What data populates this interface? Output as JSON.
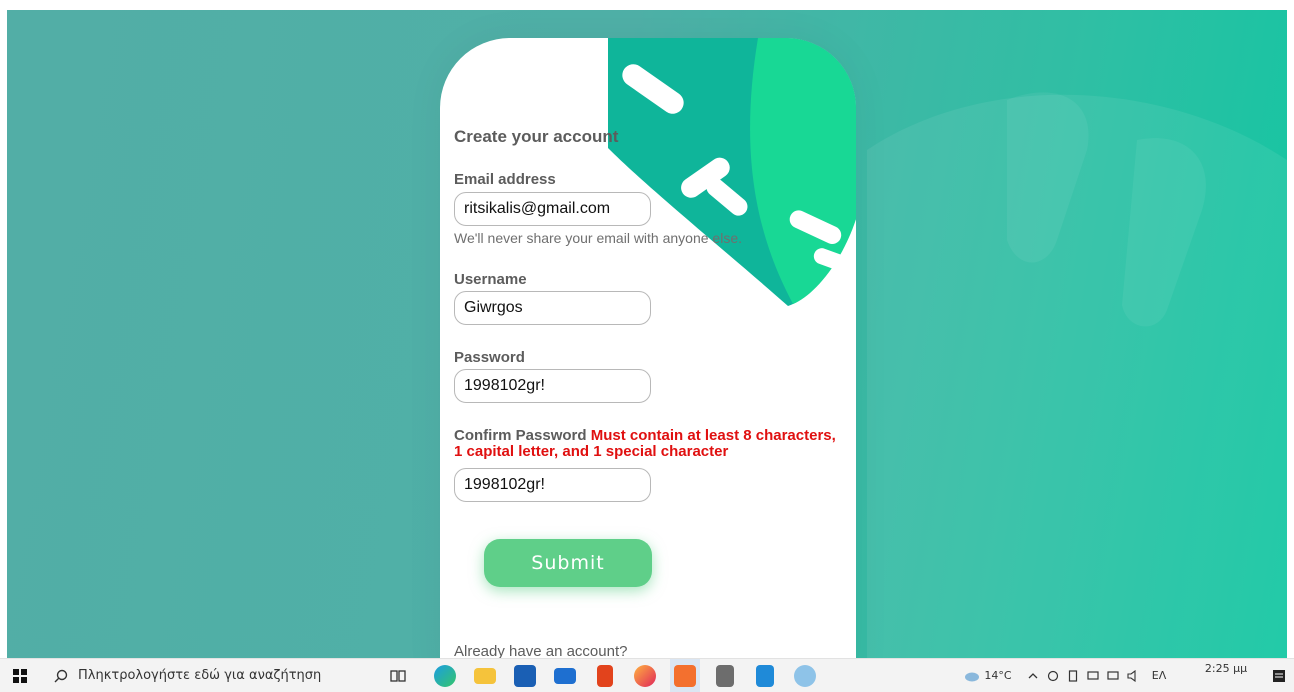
{
  "form": {
    "title": "Create your account",
    "email": {
      "label": "Email address",
      "value": "ritsikalis@gmail.com",
      "hint": "We'll never share your email with anyone else."
    },
    "username": {
      "label": "Username",
      "value": "Giwrgos"
    },
    "password": {
      "label": "Password",
      "value": "1998102gr!"
    },
    "confirm": {
      "label": "Confirm Password",
      "error": "Must contain at least 8 characters, 1 capital letter, and 1 special character",
      "value": "1998102gr!"
    },
    "submit_label": "Submit",
    "login_prompt": "Already have an account?"
  },
  "taskbar": {
    "search_placeholder": "Πληκτρολογήστε εδώ για αναζήτηση",
    "weather": "14°C",
    "language": "ΕΛ",
    "time": "2:25 μμ"
  },
  "colors": {
    "accent_teal": "#4fb0a7",
    "deco_green": "#13c19c",
    "submit_green": "#5fcf89",
    "error_red": "#e01010"
  }
}
